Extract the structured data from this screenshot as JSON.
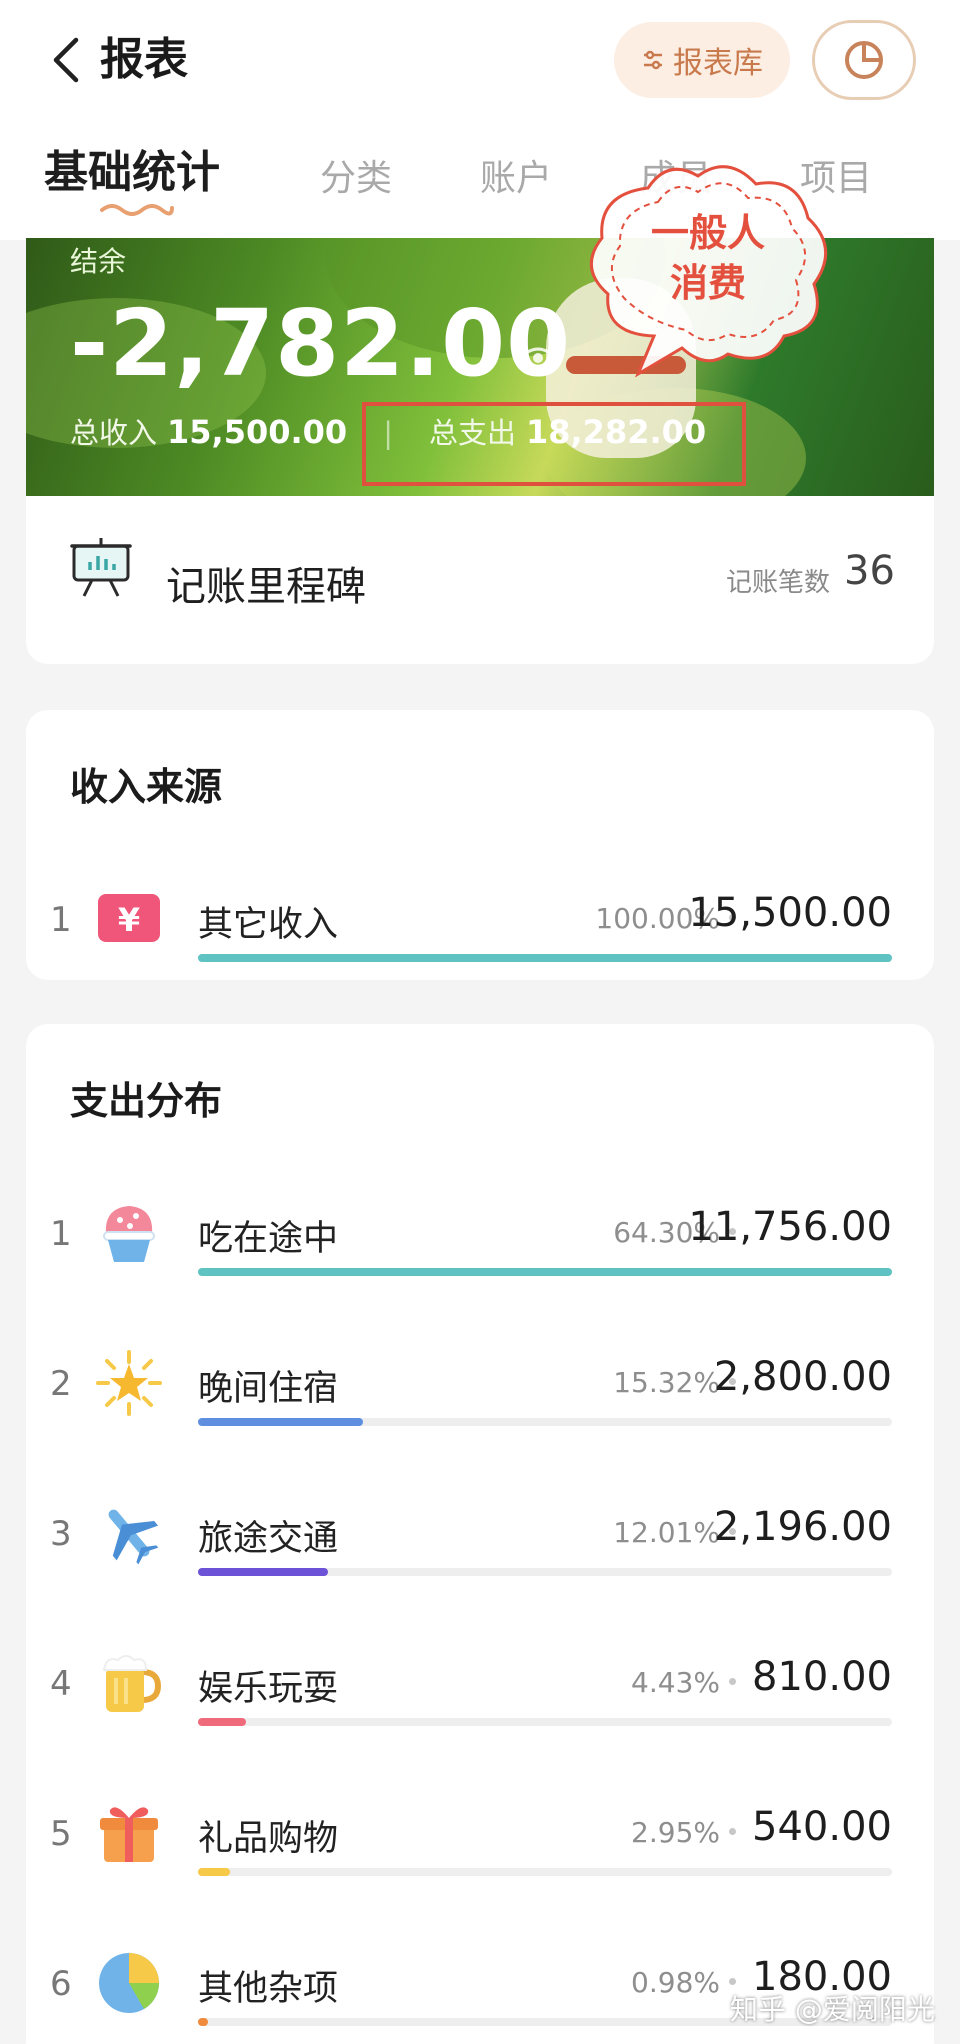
{
  "header": {
    "title": "报表",
    "library_button": "报表库"
  },
  "tabs": [
    {
      "label": "基础统计",
      "active": true
    },
    {
      "label": "分类"
    },
    {
      "label": "账户"
    },
    {
      "label": "成员"
    },
    {
      "label": "项目"
    }
  ],
  "banner": {
    "balance_label": "结余",
    "balance": "-2,782.00",
    "income_label": "总收入",
    "income": "15,500.00",
    "expense_label": "总支出",
    "expense": "18,282.00",
    "annotation": [
      "一般人",
      "消费"
    ]
  },
  "milestone": {
    "label": "记账里程碑",
    "count_label": "记账笔数",
    "count": "36"
  },
  "income_section": {
    "title": "收入来源",
    "items": [
      {
        "rank": "1",
        "name": "其它收入",
        "percent": "100.00%",
        "amount": "15,500.00",
        "ratio": 1.0,
        "color": "#5fc3c3",
        "icon": "yen-icon"
      }
    ]
  },
  "expense_section": {
    "title": "支出分布",
    "items": [
      {
        "rank": "1",
        "name": "吃在途中",
        "percent": "64.30%",
        "amount": "11,756.00",
        "ratio": 1.0,
        "color": "#5fc3c3",
        "icon": "shaved-ice-icon"
      },
      {
        "rank": "2",
        "name": "晚间住宿",
        "percent": "15.32%",
        "amount": "2,800.00",
        "ratio": 0.238,
        "color": "#5d8ee0",
        "icon": "star-icon"
      },
      {
        "rank": "3",
        "name": "旅途交通",
        "percent": "12.01%",
        "amount": "2,196.00",
        "ratio": 0.187,
        "color": "#6b52d6",
        "icon": "airplane-icon"
      },
      {
        "rank": "4",
        "name": "娱乐玩耍",
        "percent": "4.43%",
        "amount": "810.00",
        "ratio": 0.069,
        "color": "#ef6b7b",
        "icon": "beer-icon"
      },
      {
        "rank": "5",
        "name": "礼品购物",
        "percent": "2.95%",
        "amount": "540.00",
        "ratio": 0.046,
        "color": "#f7c948",
        "icon": "gift-icon"
      },
      {
        "rank": "6",
        "name": "其他杂项",
        "percent": "0.98%",
        "amount": "180.00",
        "ratio": 0.015,
        "color": "#f08a3c",
        "icon": "pie-chart-icon"
      }
    ]
  },
  "watermark": "知乎 @爱阅阳光"
}
